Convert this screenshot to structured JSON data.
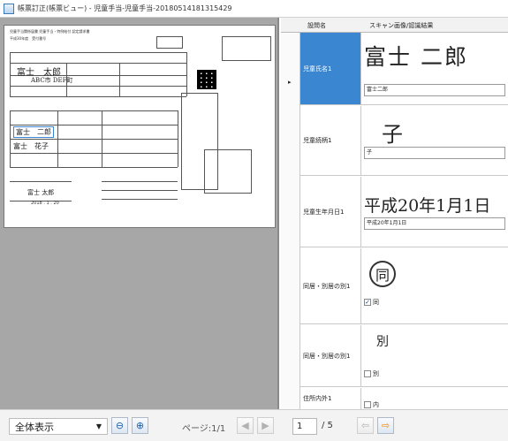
{
  "window": {
    "title": "帳票訂正(帳票ビュー) - 児童手当-児童手当-20180514181315429"
  },
  "document_preview": {
    "header_line": "児童手当関係届書 児童手当・特例給付 認定請求書",
    "office_line": "平成30年度　受付番号",
    "name_handwriting": "富士　太郎",
    "child_handwriting_1": "富士　二郎",
    "child_handwriting_2": "富士　花子",
    "address_handwriting": "ABC市 DEF町",
    "signature": "富士 太郎",
    "signature_date": "2018  .  1  .  20"
  },
  "grid": {
    "columns": [
      "設問名",
      "スキャン画像/認識結果"
    ],
    "rows": [
      {
        "name": "児童氏名1",
        "handwriting": "富士 二郎",
        "recognized": "富士二郎",
        "selected": true
      },
      {
        "name": "児童続柄1",
        "handwriting": "子",
        "recognized": "子"
      },
      {
        "name": "児童生年月日1",
        "handwriting": "平成20年1月1日",
        "recognized": "平成20年1月1日"
      },
      {
        "name": "同居・別居の別1",
        "handwriting": "同",
        "check_label": "同",
        "checked": true
      },
      {
        "name": "同居・別居の別1",
        "handwriting": "別",
        "check_label": "別",
        "checked": false
      },
      {
        "name": "住所内外1",
        "handwriting": "",
        "check_label": "内",
        "checked": false
      }
    ]
  },
  "toolbar": {
    "view_mode": "全体表示",
    "page_label": "ページ:1/1",
    "page_current": "1",
    "page_total": "/ 5"
  }
}
